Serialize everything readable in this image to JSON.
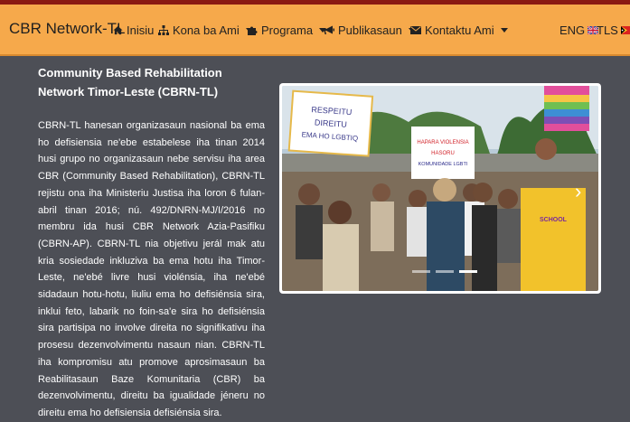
{
  "brand": "CBR Network-TL",
  "nav": {
    "home": "Inisiu",
    "about": "Kona ba Ami",
    "programs": "Programa",
    "publications": "Publikasaun",
    "contact": "Kontaktu Ami"
  },
  "languages": {
    "eng": "ENG",
    "tls": "TLS"
  },
  "content": {
    "title": "Community Based Rehabilitation Network Timor-Leste (CBRN-TL)",
    "paragraph": "CBRN-TL hanesan organizasaun nasional ba ema ho defisiensia ne'ebe estabelese iha tinan 2014 husi grupo no organizasaun nebe servisu iha area CBR (Community Based Rehabilitation), CBRN-TL rejistu ona iha Ministeriu Justisa iha loron 6 fulan-abril tinan 2016; nú. 492/DNRN-MJ/I/2016 no membru ida husi CBR Network Azia-Pasifiku (CBRN-AP). CBRN-TL nia objetivu jerál mak atu kria sosiedade inkluziva ba ema hotu iha Timor-Leste, ne'ebé livre husi violénsia, iha ne'ebé sidadaun hotu-hotu, liuliu ema ho defisiénsia sira, inklui feto, labarik no foin-sa'e sira ho defisiénsia sira partisipa no involve direita no signifikativu iha prosesu dezenvolvimentu nasaun nian. CBRN-TL iha kompromisu atu promove aprosimasaun ba Reabilitasaun Baze Komunitaria (CBR) ba dezenvolvimentu, direitu ba igualidade jéneru no direitu ema ho defisiensia defisiénsia sira."
  },
  "carousel": {
    "signs": {
      "left_line1": "RESPEITU",
      "left_line2": "DIREITU",
      "left_line3": "EMA HO LGBTIQ",
      "right_line1": "HAPARA VIOLENSIA",
      "right_line2": "HASORU",
      "right_line3": "KOMUNIDADE LGBTI",
      "shirt": "SCHOOL"
    }
  },
  "colors": {
    "navbar": "#f6a94b",
    "background": "#4d4f56",
    "topline": "#8a1a12"
  }
}
